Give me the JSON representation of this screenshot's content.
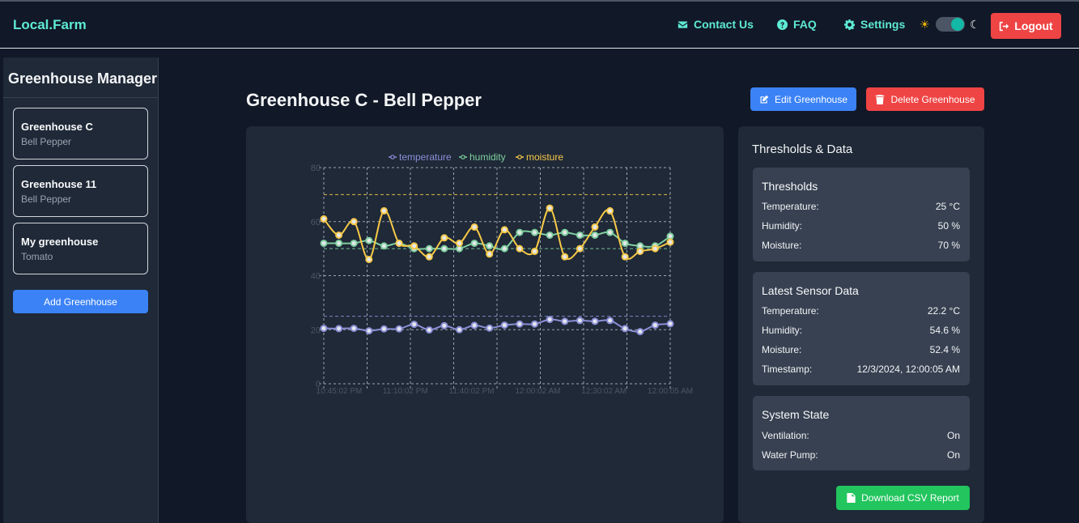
{
  "app": {
    "brand": "Local.Farm"
  },
  "nav": {
    "contact": "Contact Us",
    "faq": "FAQ",
    "settings": "Settings",
    "logout": "Logout"
  },
  "sidebar": {
    "title": "Greenhouse Manager",
    "items": [
      {
        "name": "Greenhouse C",
        "crop": "Bell Pepper"
      },
      {
        "name": "Greenhouse 11",
        "crop": "Bell Pepper"
      },
      {
        "name": "My greenhouse",
        "crop": "Tomato"
      }
    ],
    "add_label": "Add Greenhouse"
  },
  "main": {
    "title": "Greenhouse C - Bell Pepper",
    "edit_label": "Edit Greenhouse",
    "delete_label": "Delete Greenhouse"
  },
  "panel": {
    "title": "Thresholds & Data",
    "thresholds": {
      "title": "Thresholds",
      "rows": [
        {
          "label": "Temperature:",
          "value": "25 °C"
        },
        {
          "label": "Humidity:",
          "value": "50 %"
        },
        {
          "label": "Moisture:",
          "value": "70 %"
        }
      ]
    },
    "sensor": {
      "title": "Latest Sensor Data",
      "rows": [
        {
          "label": "Temperature:",
          "value": "22.2 °C"
        },
        {
          "label": "Humidity:",
          "value": "54.6 %"
        },
        {
          "label": "Moisture:",
          "value": "52.4 %"
        },
        {
          "label": "Timestamp:",
          "value": "12/3/2024, 12:00:05 AM"
        }
      ]
    },
    "system": {
      "title": "System State",
      "rows": [
        {
          "label": "Ventilation:",
          "value": "On"
        },
        {
          "label": "Water Pump:",
          "value": "On"
        }
      ]
    },
    "csv_label": "Download CSV Report"
  },
  "colors": {
    "temperature": "#8b8fd8",
    "humidity": "#7fcf9f",
    "moisture": "#f7c948",
    "accent": "#5eead4"
  },
  "chart_data": {
    "type": "line",
    "ylim": [
      0,
      80
    ],
    "yticks": [
      0,
      20,
      40,
      60,
      80
    ],
    "xtick_labels": [
      "10:45:02 PM",
      "11:10:02 PM",
      "11:40:02 PM",
      "12:00:02 AM",
      "12:30:02 AM",
      "12:00:05 AM"
    ],
    "thresholds": [
      25,
      50,
      70
    ],
    "grid": true,
    "legend_position": "top",
    "series": [
      {
        "name": "temperature",
        "values": [
          20.5,
          20.4,
          20.5,
          19.6,
          20.3,
          20.3,
          22.0,
          19.9,
          21.5,
          20.0,
          21.6,
          20.6,
          21.7,
          22.1,
          22.1,
          23.8,
          23.1,
          23.4,
          23.1,
          23.4,
          20.4,
          19.3,
          21.7,
          22.2
        ]
      },
      {
        "name": "humidity",
        "values": [
          52,
          52,
          52,
          53,
          51,
          52,
          50,
          50,
          50,
          50,
          52,
          51,
          50,
          56,
          56,
          55,
          56,
          55,
          55,
          56,
          52,
          51,
          51,
          54.6
        ]
      },
      {
        "name": "moisture",
        "values": [
          61,
          55,
          60,
          46,
          64,
          52,
          51,
          47,
          54,
          52,
          58,
          48,
          57,
          50,
          49,
          65,
          47,
          50,
          58,
          64,
          47,
          49,
          50,
          52.4
        ]
      }
    ]
  }
}
